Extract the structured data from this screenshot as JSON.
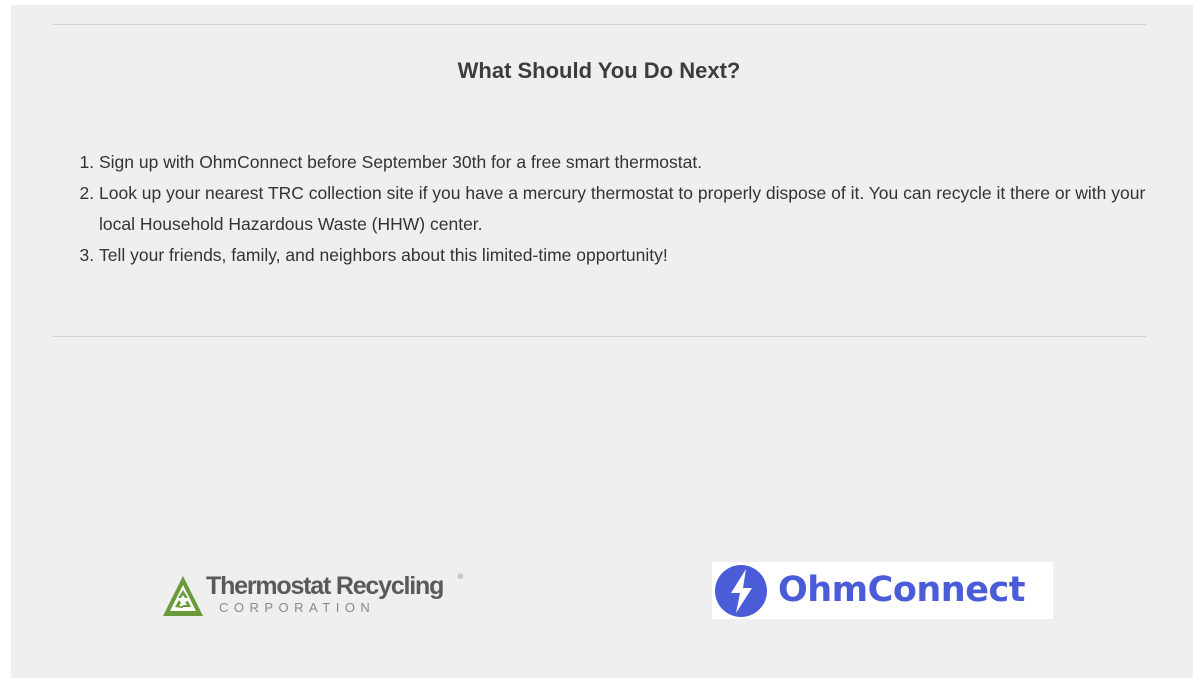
{
  "section": {
    "heading": "What Should You Do Next?",
    "steps": [
      "Sign up with OhmConnect before September 30th for a free smart thermostat.",
      "Look up your nearest TRC collection site if you have a mercury thermostat to properly dispose of it. You can recycle it there or with your local Household Hazardous Waste (HHW) center.",
      "Tell your friends, family, and neighbors about this limited-time opportunity!"
    ]
  },
  "logos": {
    "trc": {
      "name": "Thermostat Recycling",
      "subtitle": "CORPORATION",
      "registered_mark": "®",
      "icon": "recycle-triangle-icon",
      "color": "#6a9a3a"
    },
    "ohmconnect": {
      "name": "OhmConnect",
      "icon": "lightning-bolt-circle-icon",
      "color": "#4a5cd8"
    }
  }
}
